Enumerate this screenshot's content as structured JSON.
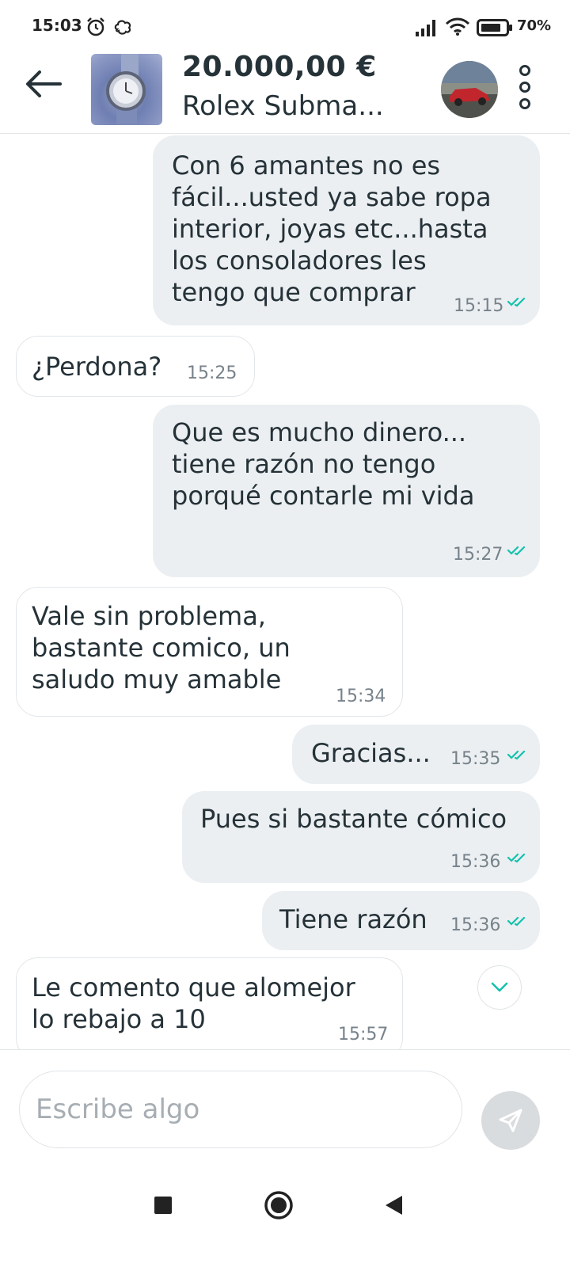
{
  "status_bar": {
    "time": "15:03",
    "battery": "70%",
    "icons": [
      "alarm-clock-icon",
      "sync-icon",
      "signal-icon",
      "wifi-icon",
      "battery-icon"
    ]
  },
  "header": {
    "price": "20.000,00 €",
    "product_name": "Rolex Subma...",
    "icons": [
      "back-arrow-icon",
      "product-thumbnail",
      "user-avatar",
      "more-vertical-icon"
    ]
  },
  "messages": [
    {
      "side": "sent",
      "text": "Con 6 amantes no es\nfácil...usted ya sabe ropa\ninterior, joyas etc...hasta\nlos consoladores les\ntengo que comprar",
      "time": "15:15",
      "read": true
    },
    {
      "side": "received",
      "text": "¿Perdona?",
      "time": "15:25"
    },
    {
      "side": "sent",
      "text": "Que es mucho dinero...\ntiene razón no tengo\nporqué contarle mi vida",
      "time": "15:27",
      "read": true
    },
    {
      "side": "received",
      "text": "Vale sin problema,\nbastante comico, un\nsaludo muy amable",
      "time": "15:34"
    },
    {
      "side": "sent",
      "text": "Gracias...",
      "time": "15:35",
      "read": true
    },
    {
      "side": "sent",
      "text": "Pues si bastante cómico",
      "time": "15:36",
      "read": true
    },
    {
      "side": "sent",
      "text": "Tiene razón",
      "time": "15:36",
      "read": true
    },
    {
      "side": "received",
      "text": "Le comento que alomejor\nlo rebajo a 10",
      "time": "15:57"
    }
  ],
  "input": {
    "placeholder": "Escribe algo",
    "value": ""
  },
  "colors": {
    "text": "#253238",
    "sent_bubble": "#ebeff2",
    "read_check": "#13c1ac",
    "time": "#77828a"
  }
}
